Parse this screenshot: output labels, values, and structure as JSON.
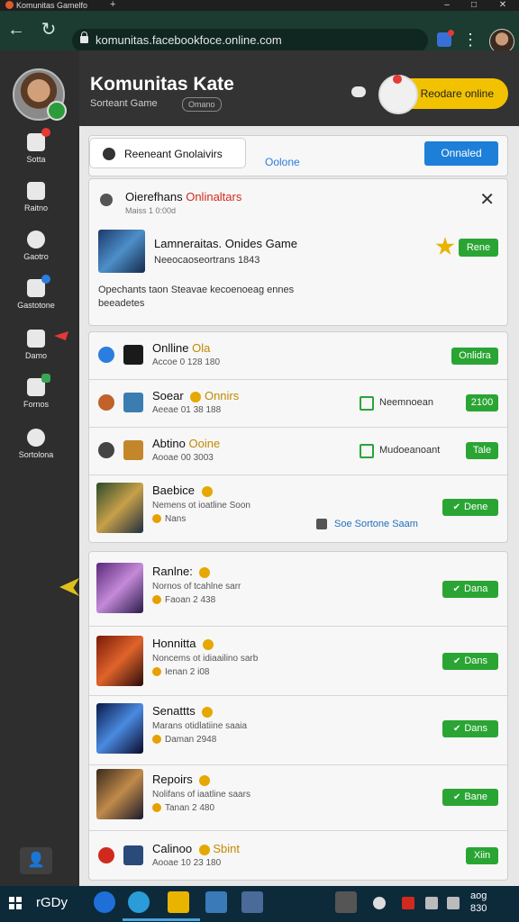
{
  "browser": {
    "tab_title": "Komunitas Gamelfo",
    "url": "komunitas.facebookfoce.online.com",
    "new_tab_symbol": "+",
    "window_buttons": [
      "–",
      "□",
      "✕"
    ]
  },
  "sidebar": {
    "items": [
      {
        "label": "Sotta",
        "icon": "gamepad-icon"
      },
      {
        "label": "Raitno",
        "icon": "puzzle-icon"
      },
      {
        "label": "Gaotro",
        "icon": "sword-icon"
      },
      {
        "label": "Gastotone",
        "icon": "chat-icon"
      },
      {
        "label": "Damo",
        "icon": "camera-icon"
      },
      {
        "label": "Fornos",
        "icon": "trophy-icon"
      },
      {
        "label": "Sortolona",
        "icon": "settings-icon"
      }
    ],
    "bottom_icon": "user-icon"
  },
  "header": {
    "title": "Komunitas Kate",
    "subtitle": "Sorteant Game",
    "chip": "Omano",
    "status_label": "Reodare online"
  },
  "toolbar": {
    "filter_label": "Reeneant Gnolaivirs",
    "tab_label": "Oolone",
    "online_button": "Onnaled"
  },
  "notification": {
    "title_prefix": "Oierefhans",
    "title_highlight": "Onlinaltars",
    "subtitle": "Maiss 1 0:00d",
    "game_title": "Lamneraitas. Onides Game",
    "game_subtitle": "Neeocaoseortrans 1843",
    "description": "Opechants taon Steavae kecoenoeag ennes beeadetes",
    "button": "Rene"
  },
  "list1": [
    {
      "name": "Onlline",
      "badge": "Ola",
      "line2": "Accoe 0 128 180",
      "button": "Onlidra"
    },
    {
      "name": "Soear",
      "badge": "Onnirs",
      "line2": "Aeeae 01 38 188",
      "mid": "Neemnoean",
      "button": "2100"
    },
    {
      "name": "Abtino",
      "badge": "Ooine",
      "line2": "Aooae 00 3003",
      "mid": "Mudoeanoant",
      "button": "Tale"
    },
    {
      "name": "Baebice",
      "line2": "Nemens ot ioatline Soon",
      "line3": "Nans",
      "mid": "Soe Sortone Saam",
      "button": "Dene"
    }
  ],
  "list2": [
    {
      "name": "Ranlne:",
      "line2": "Nornos of tcahlne sarr",
      "line3": "Faoan 2 438",
      "button": "Dana"
    },
    {
      "name": "Honnitta",
      "line2": "Noncems ot idiaailino sarb",
      "line3": "Ienan 2 i08",
      "button": "Dans"
    },
    {
      "name": "Senattts",
      "line2": "Marans otidlatiine saaia",
      "line3": "Daman 2948",
      "button": "Dans"
    },
    {
      "name": "Repoirs",
      "line2": "Nolifans of iaatline saars",
      "line3": "Tanan 2 480",
      "button": "Bane"
    },
    {
      "name": "Calinoo",
      "badge": "Sbint",
      "line2": "Aooae 10 23 180",
      "button": "Xiin"
    }
  ],
  "taskbar": {
    "search_label": "rGDy",
    "time": "aog",
    "date": "830"
  },
  "colors": {
    "accent_blue": "#1e7fd8",
    "accent_green": "#2aa534",
    "status_yellow": "#f2c200",
    "highlight_red": "#d02a1e"
  }
}
